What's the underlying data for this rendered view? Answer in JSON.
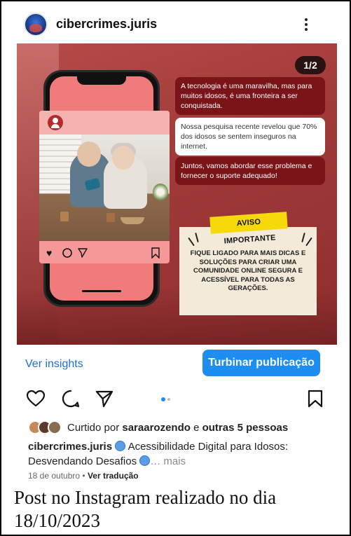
{
  "header": {
    "username": "cibercrimes.juris",
    "more_icon": "more-vertical-icon"
  },
  "post": {
    "page_indicator": "1/2",
    "bubbles": [
      "A tecnologia é uma maravilha, mas para muitos idosos, é uma fronteira a ser conquistada.",
      "Nossa pesquisa recente revelou que 70% dos idosos se sentem inseguros na internet.",
      "Juntos, vamos abordar esse problema e fornecer o suporte adequado!"
    ],
    "notice_tag": "AVISO IMPORTANTE",
    "notice_text": "FIQUE LIGADO PARA MAIS DICAS E SOLUÇÕES PARA CRIAR UMA COMUNIDADE ONLINE SEGURA E ACESSÍVEL PARA TODAS AS GERAÇÕES."
  },
  "insights": {
    "view_label": "Ver insights",
    "boost_label": "Turbinar publicação"
  },
  "likes": {
    "prefix": "Curtido por ",
    "user": "saraarozendo",
    "connector": " e ",
    "others": "outras 5 pessoas"
  },
  "caption": {
    "username": "cibercrimes.juris",
    "text": " Acessibilidade Digital para Idosos: Desvendando Desafios ",
    "more": "… mais"
  },
  "meta": {
    "date": "18 de outubro",
    "separator": " • ",
    "translate": "Ver tradução"
  },
  "bottom_caption": "Post no Instagram realizado no dia 18/10/2023",
  "colors": {
    "accent_blue": "#1d8df2",
    "link_blue": "#1d6fd6",
    "post_red": "#a13b3a",
    "bubble_dark": "#7a1418",
    "notice_yellow": "#f5d90a"
  }
}
